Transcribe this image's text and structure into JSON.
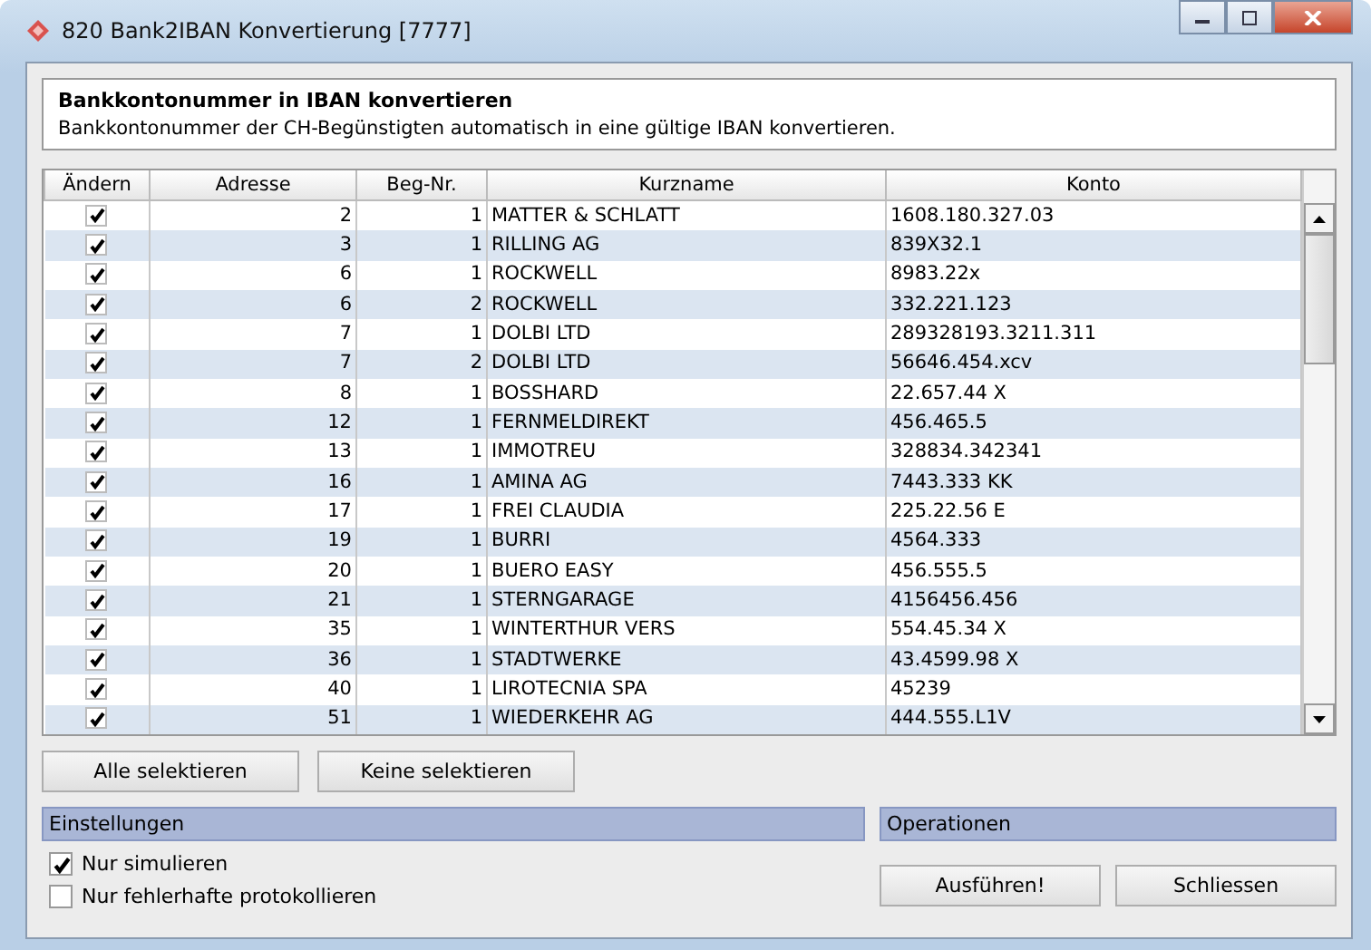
{
  "window": {
    "title": "820 Bank2IBAN Konvertierung [7777]"
  },
  "header": {
    "title": "Bankkontonummer in IBAN konvertieren",
    "description": "Bankkontonummer der CH-Begünstigten automatisch in eine gültige IBAN konvertieren."
  },
  "table": {
    "columns": [
      "Ändern",
      "Adresse",
      "Beg-Nr.",
      "Kurzname",
      "Konto"
    ],
    "rows": [
      {
        "checked": true,
        "adresse": "2",
        "beg_nr": "1",
        "kurzname": "MATTER & SCHLATT",
        "konto": "1608.180.327.03"
      },
      {
        "checked": true,
        "adresse": "3",
        "beg_nr": "1",
        "kurzname": "RILLING AG",
        "konto": "839X32.1"
      },
      {
        "checked": true,
        "adresse": "6",
        "beg_nr": "1",
        "kurzname": "ROCKWELL",
        "konto": "8983.22x"
      },
      {
        "checked": true,
        "adresse": "6",
        "beg_nr": "2",
        "kurzname": "ROCKWELL",
        "konto": "332.221.123"
      },
      {
        "checked": true,
        "adresse": "7",
        "beg_nr": "1",
        "kurzname": "DOLBI LTD",
        "konto": "289328193.3211.311"
      },
      {
        "checked": true,
        "adresse": "7",
        "beg_nr": "2",
        "kurzname": "DOLBI LTD",
        "konto": "56646.454.xcv"
      },
      {
        "checked": true,
        "adresse": "8",
        "beg_nr": "1",
        "kurzname": "BOSSHARD",
        "konto": "22.657.44 X"
      },
      {
        "checked": true,
        "adresse": "12",
        "beg_nr": "1",
        "kurzname": "FERNMELDIREKT",
        "konto": "456.465.5"
      },
      {
        "checked": true,
        "adresse": "13",
        "beg_nr": "1",
        "kurzname": "IMMOTREU",
        "konto": "328834.342341"
      },
      {
        "checked": true,
        "adresse": "16",
        "beg_nr": "1",
        "kurzname": "AMINA AG",
        "konto": "7443.333 KK"
      },
      {
        "checked": true,
        "adresse": "17",
        "beg_nr": "1",
        "kurzname": "FREI CLAUDIA",
        "konto": "225.22.56 E"
      },
      {
        "checked": true,
        "adresse": "19",
        "beg_nr": "1",
        "kurzname": "BURRI",
        "konto": "4564.333"
      },
      {
        "checked": true,
        "adresse": "20",
        "beg_nr": "1",
        "kurzname": "BUERO EASY",
        "konto": "456.555.5"
      },
      {
        "checked": true,
        "adresse": "21",
        "beg_nr": "1",
        "kurzname": "STERNGARAGE",
        "konto": "4156456.456"
      },
      {
        "checked": true,
        "adresse": "35",
        "beg_nr": "1",
        "kurzname": "WINTERTHUR VERS",
        "konto": "554.45.34 X"
      },
      {
        "checked": true,
        "adresse": "36",
        "beg_nr": "1",
        "kurzname": "STADTWERKE",
        "konto": "43.4599.98 X"
      },
      {
        "checked": true,
        "adresse": "40",
        "beg_nr": "1",
        "kurzname": "LIROTECNIA SPA",
        "konto": "45239"
      },
      {
        "checked": true,
        "adresse": "51",
        "beg_nr": "1",
        "kurzname": "WIEDERKEHR AG",
        "konto": "444.555.L1V"
      }
    ]
  },
  "selection_buttons": [
    "Alle selektieren",
    "Keine selektieren"
  ],
  "settings": {
    "title": "Einstellungen",
    "options": [
      {
        "label": "Nur simulieren",
        "checked": true
      },
      {
        "label": "Nur fehlerhafte protokollieren",
        "checked": false
      }
    ]
  },
  "operations": {
    "title": "Operationen",
    "buttons": [
      "Ausführen!",
      "Schliessen"
    ]
  }
}
